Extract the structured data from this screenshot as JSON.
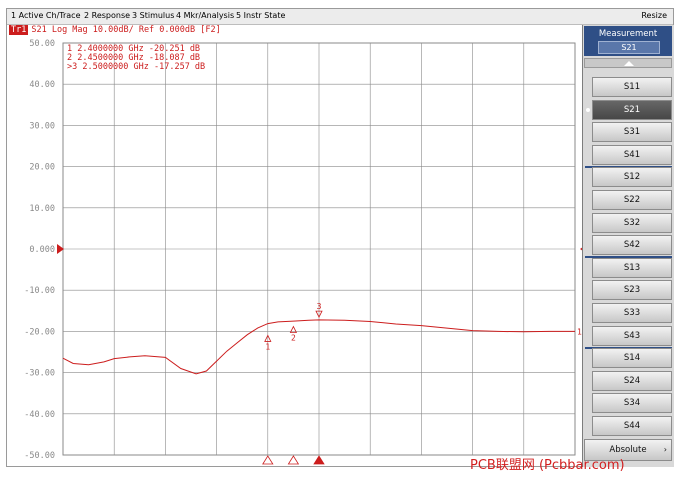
{
  "menu": {
    "items": [
      "1 Active Ch/Trace",
      "2 Response",
      "3 Stimulus",
      "4 Mkr/Analysis",
      "5 Instr State"
    ],
    "resize": "Resize"
  },
  "trace": {
    "badge": "Tr1",
    "header": "S21 Log Mag 10.00dB/ Ref 0.000dB [F2]",
    "color": "#cc1d1d",
    "markers": [
      {
        "label": "1",
        "freq_ghz": 2.4,
        "db": -20.251,
        "readout": "1  2.4000000 GHz -20.251 dB"
      },
      {
        "label": "2",
        "freq_ghz": 2.45,
        "db": -18.087,
        "readout": "2  2.4500000 GHz -18.087 dB"
      },
      {
        "label": "3",
        "freq_ghz": 2.5,
        "db": -17.257,
        "readout": ">3  2.5000000 GHz -17.257 dB",
        "active": true
      }
    ],
    "end_label": "1"
  },
  "chart_data": {
    "type": "line",
    "ylim": [
      -50,
      50
    ],
    "yticks": [
      "50.00",
      "40.00",
      "30.00",
      "20.00",
      "10.00",
      "0.000",
      "-10.00",
      "-20.00",
      "-30.00",
      "-40.00",
      "-50.00"
    ],
    "x_divisions": 10,
    "reference_db": 0,
    "series": [
      {
        "x": [
          0,
          0.02,
          0.05,
          0.08,
          0.1,
          0.13,
          0.16,
          0.2,
          0.23,
          0.26,
          0.28,
          0.3,
          0.32,
          0.34,
          0.36,
          0.38,
          0.4,
          0.42,
          0.45,
          0.48,
          0.5,
          0.55,
          0.6,
          0.65,
          0.7,
          0.75,
          0.8,
          0.85,
          0.9,
          0.95,
          1.0
        ],
        "y": [
          -26.5,
          -27.8,
          -28.1,
          -27.4,
          -26.6,
          -26.2,
          -25.9,
          -26.3,
          -29.0,
          -30.3,
          -29.6,
          -27.2,
          -24.8,
          -22.8,
          -20.8,
          -19.2,
          -18.1,
          -17.7,
          -17.5,
          -17.3,
          -17.2,
          -17.3,
          -17.6,
          -18.2,
          -18.6,
          -19.2,
          -19.8,
          -20.0,
          -20.1,
          -20.0,
          -20.0
        ]
      }
    ]
  },
  "softkeys": {
    "title": "Measurement",
    "current": "S21",
    "items": [
      {
        "label": "S11",
        "selected": false
      },
      {
        "label": "S21",
        "selected": true
      },
      {
        "label": "S31",
        "selected": false
      },
      {
        "label": "S41",
        "selected": false
      },
      {
        "label": "S12",
        "selected": false
      },
      {
        "label": "S22",
        "selected": false
      },
      {
        "label": "S32",
        "selected": false
      },
      {
        "label": "S42",
        "selected": false
      },
      {
        "label": "S13",
        "selected": false
      },
      {
        "label": "S23",
        "selected": false
      },
      {
        "label": "S33",
        "selected": false
      },
      {
        "label": "S43",
        "selected": false
      },
      {
        "label": "S14",
        "selected": false
      },
      {
        "label": "S24",
        "selected": false
      },
      {
        "label": "S34",
        "selected": false
      },
      {
        "label": "S44",
        "selected": false
      }
    ],
    "absolute": "Absolute",
    "absolute_icon": "chevron-right-icon"
  },
  "watermark": "PCB联盟网 (Pcbbar.com)"
}
